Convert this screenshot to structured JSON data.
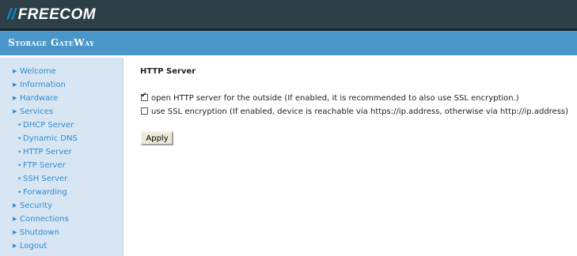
{
  "brand": {
    "slashes": "//",
    "name": "FREECOM"
  },
  "product": "Storage GateWay",
  "nav": {
    "welcome": "Welcome",
    "information": "Information",
    "hardware": "Hardware",
    "services": "Services",
    "dhcp_server": "DHCP Server",
    "dynamic_dns": "Dynamic DNS",
    "http_server": "HTTP Server",
    "ftp_server": "FTP Server",
    "ssh_server": "SSH Server",
    "forwarding": "Forwarding",
    "security": "Security",
    "connections": "Connections",
    "shutdown": "Shutdown",
    "logout": "Logout"
  },
  "section": {
    "title": "HTTP Server",
    "option_outside": {
      "label": "open HTTP server for the outside (If enabled, it is recommended to also use SSL encryption.)",
      "checked": true
    },
    "option_ssl": {
      "label": "use SSL encryption (If enabled, device is reachable via https://ip.address, otherwise via http://ip.address)",
      "checked": false
    },
    "apply_label": "Apply"
  },
  "colors": {
    "header_dark": "#2e4047",
    "header_blue": "#4a96c9",
    "sidebar_bg": "#d7e6f2",
    "link": "#2f8bd0"
  }
}
